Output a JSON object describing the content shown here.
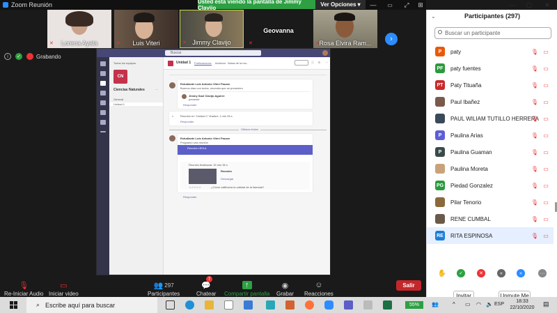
{
  "window": {
    "title": "Zoom Reunión",
    "share_banner": "Usted está viendo la pantalla de Jimmy Clavijo",
    "view_options": "Ver Opciones"
  },
  "video_strip": {
    "tiles": [
      {
        "name": "Lorena Ayala"
      },
      {
        "name": "Luis Viteri"
      },
      {
        "name": "Jimmy Clavijo"
      },
      {
        "name": "Geovanna"
      },
      {
        "name": "Rosa Elvira Ram..."
      }
    ]
  },
  "recording": {
    "label": "Grabando"
  },
  "teams": {
    "search_placeholder": "Buscar",
    "back_label": "Todos los equipos",
    "team_initials": "CN",
    "team_name": "Ciencias Naturales",
    "channels": [
      "General",
      "Unidad 1"
    ],
    "channel_title": "Unidad 1",
    "channel_tabs": [
      "Publicaciones",
      "Archivos",
      "Notas de la reu..."
    ],
    "messages": [
      {
        "author": "Estudiante Luis Antonio Viteri Pauzar",
        "text": "Buenos días con todos, necesita que se presenten"
      },
      {
        "author": "Jimmy Saul Clavijo Aguirre",
        "text": "presente"
      },
      {
        "text": "Reunión en \"Unidad 1\" finalizó: 1 min 28 s"
      },
      {
        "author": "Estudiante Luis Antonio Viteri Pauzar",
        "text": "Programó una reunión"
      },
      {
        "text": "Reunión UEILA"
      },
      {
        "text": "Reunión finalizada: 15 min 36 s"
      },
      {
        "text": "¿Cómo calificaría la calidad de la llamada?"
      }
    ],
    "reply_label": "Responder",
    "divider_label": "Últimos leídos",
    "recording_title": "Reunión",
    "download_label": "Descargar"
  },
  "toolbar": {
    "mute_label": "Re-Iniciar Audio",
    "video_label": "Iniciar video",
    "participants_label": "Participantes",
    "participants_count": "297",
    "chat_label": "Chatear",
    "chat_badge": "7",
    "share_label": "Compartir pantalla",
    "record_label": "Grabar",
    "reactions_label": "Reacciones",
    "leave_label": "Salir"
  },
  "panel": {
    "title": "Participantes (297)",
    "search_placeholder": "Buscar un participante",
    "participants": [
      {
        "initials": "P",
        "name": "paty",
        "color": "#e8590c"
      },
      {
        "initials": "PF",
        "name": "paty fuentes",
        "color": "#2b9a3e"
      },
      {
        "initials": "PT",
        "name": "Paty Tituaña",
        "color": "#c92a2a"
      },
      {
        "initials": "",
        "name": "Paul Ibañez",
        "color": "#7a5a4a"
      },
      {
        "initials": "",
        "name": "PAUL WILIAM TUTILLO HERRERA",
        "color": "#3b4a5a"
      },
      {
        "initials": "P",
        "name": "Paulina Arias",
        "color": "#5c5fd6"
      },
      {
        "initials": "P",
        "name": "Paulina Guaman",
        "color": "#3a4a4a"
      },
      {
        "initials": "",
        "name": "Paulina Moreta",
        "color": "#c9a27a"
      },
      {
        "initials": "PG",
        "name": "Piedad Gonzalez",
        "color": "#2b9a3e"
      },
      {
        "initials": "",
        "name": "Pilar Tenorio",
        "color": "#8a6a3a"
      },
      {
        "initials": "",
        "name": "RENE CUMBAL",
        "color": "#6a5a4a"
      },
      {
        "initials": "RE",
        "name": "RITA ESPINOSA",
        "color": "#1c7ed6"
      }
    ],
    "invite_label": "Invitar",
    "unmute_label": "Unmute Me"
  },
  "taskbar": {
    "search_placeholder": "Escribe aquí para buscar",
    "battery": "55%",
    "language": "ESP",
    "time": "18:33",
    "date": "22/10/2020"
  }
}
